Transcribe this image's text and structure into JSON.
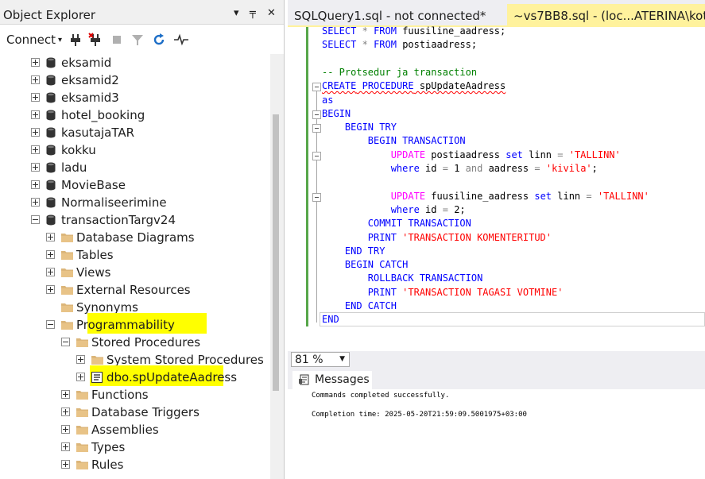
{
  "object_explorer": {
    "title": "Object Explorer",
    "pin_glyph": "▾",
    "pin2_glyph": "╤",
    "close_glyph": "✕",
    "connect_label": "Connect",
    "connect_arrow": "▾",
    "tree": [
      {
        "label": "eksamid",
        "type": "database",
        "expander": "plus"
      },
      {
        "label": "eksamid2",
        "type": "database",
        "expander": "plus"
      },
      {
        "label": "eksamid3",
        "type": "database",
        "expander": "plus"
      },
      {
        "label": "hotel_booking",
        "type": "database",
        "expander": "plus"
      },
      {
        "label": "kasutajaTAR",
        "type": "database",
        "expander": "plus"
      },
      {
        "label": "kokku",
        "type": "database",
        "expander": "plus"
      },
      {
        "label": "ladu",
        "type": "database",
        "expander": "plus"
      },
      {
        "label": "MovieBase",
        "type": "database",
        "expander": "plus"
      },
      {
        "label": "Normaliseerimine",
        "type": "database",
        "expander": "plus"
      },
      {
        "label": "transactionTargv24",
        "type": "database",
        "expander": "minus"
      },
      {
        "label": "Database Diagrams",
        "type": "folder",
        "expander": "plus"
      },
      {
        "label": "Tables",
        "type": "folder",
        "expander": "plus"
      },
      {
        "label": "Views",
        "type": "folder",
        "expander": "plus"
      },
      {
        "label": "External Resources",
        "type": "folder",
        "expander": "plus"
      },
      {
        "label": "Synonyms",
        "type": "folder",
        "expander": "none"
      },
      {
        "label": "Programmability",
        "type": "folder",
        "expander": "minus"
      },
      {
        "label": "Stored Procedures",
        "type": "folder",
        "expander": "minus"
      },
      {
        "label": "System Stored Procedures",
        "type": "folder",
        "expander": "plus"
      },
      {
        "label": "dbo.spUpdateAadress",
        "type": "procedure",
        "expander": "plus"
      },
      {
        "label": "Functions",
        "type": "folder",
        "expander": "plus"
      },
      {
        "label": "Database Triggers",
        "type": "folder",
        "expander": "plus"
      },
      {
        "label": "Assemblies",
        "type": "folder",
        "expander": "plus"
      },
      {
        "label": "Types",
        "type": "folder",
        "expander": "plus"
      },
      {
        "label": "Rules",
        "type": "folder",
        "expander": "plus"
      }
    ]
  },
  "tabs": [
    {
      "label": "SQLQuery1.sql - not connected*",
      "active": false
    },
    {
      "label": "~vs7BB8.sql - (loc...ATERINA\\kotik (6",
      "active": true
    }
  ],
  "editor": {
    "lines": [
      [
        {
          "t": "SELECT",
          "c": "kw"
        },
        {
          "t": " "
        },
        {
          "t": "*",
          "c": "gr"
        },
        {
          "t": " "
        },
        {
          "t": "FROM",
          "c": "kw"
        },
        {
          "t": " fuusiline_aadress;"
        }
      ],
      [
        {
          "t": "SELECT",
          "c": "kw"
        },
        {
          "t": " "
        },
        {
          "t": "*",
          "c": "gr"
        },
        {
          "t": " "
        },
        {
          "t": "FROM",
          "c": "kw"
        },
        {
          "t": " postiaadress;"
        }
      ],
      [],
      [
        {
          "t": "-- Protsedur ja transaction",
          "c": "cm"
        }
      ],
      [
        {
          "t": "CREATE",
          "c": "kw sq"
        },
        {
          "t": " ",
          "c": "sq"
        },
        {
          "t": "PROCEDURE",
          "c": "kw sq"
        },
        {
          "t": " spUpdateAadress",
          "c": "sq"
        }
      ],
      [
        {
          "t": "as",
          "c": "kw"
        }
      ],
      [
        {
          "t": "BEGIN",
          "c": "kw"
        }
      ],
      [
        {
          "t": "    "
        },
        {
          "t": "BEGIN TRY",
          "c": "kw"
        }
      ],
      [
        {
          "t": "        "
        },
        {
          "t": "BEGIN TRANSACTION",
          "c": "kw"
        }
      ],
      [
        {
          "t": "            "
        },
        {
          "t": "UPDATE",
          "c": "fn"
        },
        {
          "t": " postiaadress "
        },
        {
          "t": "set",
          "c": "kw"
        },
        {
          "t": " linn "
        },
        {
          "t": "=",
          "c": "gr"
        },
        {
          "t": " "
        },
        {
          "t": "'TALLINN'",
          "c": "str"
        }
      ],
      [
        {
          "t": "            "
        },
        {
          "t": "where",
          "c": "kw"
        },
        {
          "t": " id "
        },
        {
          "t": "=",
          "c": "gr"
        },
        {
          "t": " 1 "
        },
        {
          "t": "and",
          "c": "gr"
        },
        {
          "t": " aadress "
        },
        {
          "t": "=",
          "c": "gr"
        },
        {
          "t": " "
        },
        {
          "t": "'kivila'",
          "c": "str"
        },
        {
          "t": ";"
        }
      ],
      [],
      [
        {
          "t": "            "
        },
        {
          "t": "UPDATE",
          "c": "fn"
        },
        {
          "t": " fuusiline_aadress "
        },
        {
          "t": "set",
          "c": "kw"
        },
        {
          "t": " linn "
        },
        {
          "t": "=",
          "c": "gr"
        },
        {
          "t": " "
        },
        {
          "t": "'TALLINN'",
          "c": "str"
        }
      ],
      [
        {
          "t": "            "
        },
        {
          "t": "where",
          "c": "kw"
        },
        {
          "t": " id "
        },
        {
          "t": "=",
          "c": "gr"
        },
        {
          "t": " 2;"
        }
      ],
      [
        {
          "t": "        "
        },
        {
          "t": "COMMIT TRANSACTION",
          "c": "kw"
        }
      ],
      [
        {
          "t": "        "
        },
        {
          "t": "PRINT",
          "c": "kw"
        },
        {
          "t": " "
        },
        {
          "t": "'TRANSACTION KOMENTERITUD'",
          "c": "str"
        }
      ],
      [
        {
          "t": "    "
        },
        {
          "t": "END TRY",
          "c": "kw"
        }
      ],
      [
        {
          "t": "    "
        },
        {
          "t": "BEGIN CATCH",
          "c": "kw"
        }
      ],
      [
        {
          "t": "        "
        },
        {
          "t": "ROLLBACK TRANSACTION",
          "c": "kw"
        }
      ],
      [
        {
          "t": "        "
        },
        {
          "t": "PRINT",
          "c": "kw"
        },
        {
          "t": " "
        },
        {
          "t": "'TRANSACTION TAGASI VOTMINE'",
          "c": "str"
        }
      ],
      [
        {
          "t": "    "
        },
        {
          "t": "END CATCH",
          "c": "kw"
        }
      ],
      [
        {
          "t": "END",
          "c": "kw"
        }
      ]
    ]
  },
  "zoom": {
    "value": "81 %",
    "arrow": "▼"
  },
  "results": {
    "tab_label": "Messages",
    "lines": [
      "Commands completed successfully.",
      "",
      "Completion time: 2025-05-20T21:59:09.5001975+03:00"
    ]
  },
  "colors": {
    "highlight": "#ffff00",
    "active_tab": "#fff29d",
    "change_bar": "#57a64a",
    "keyword": "#0000ff",
    "string": "#ff0000",
    "comment": "#008000"
  }
}
